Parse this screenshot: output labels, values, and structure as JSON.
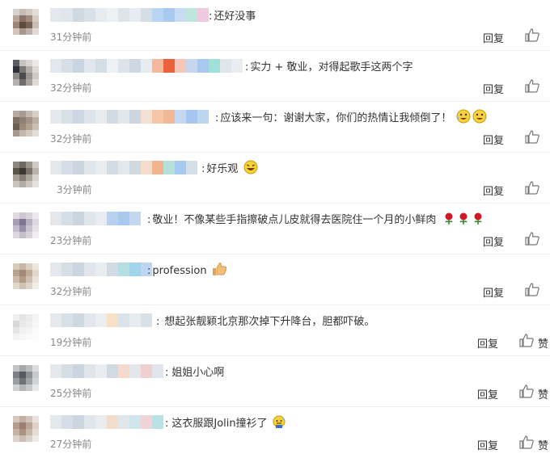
{
  "reply_label": "回复",
  "zan_label": "赞",
  "colors": {
    "text": "#333333",
    "time": "#888888",
    "divider": "#eeeeee"
  },
  "comments": [
    {
      "text": "还好没事",
      "time": "31分钟前"
    },
    {
      "text": "实力 + 敬业，对得起歌手这两个字",
      "time": "32分钟前"
    },
    {
      "text": "应该来一句：谢谢大家，你们的热情让我倾倒了！",
      "time": "32分钟前"
    },
    {
      "text": "好乐观",
      "time": "3分钟前"
    },
    {
      "text": "敬业！不像某些手指擦破点儿皮就得去医院住一个月的小鲜肉",
      "time": "23分钟前"
    },
    {
      "text": "profession",
      "time": "32分钟前"
    },
    {
      "text": "想起张靓颖北京那次掉下升降台，胆都吓破。",
      "time": "19分钟前"
    },
    {
      "text": "姐姐小心啊",
      "time": "25分钟前"
    },
    {
      "text": "这衣服跟Jolin撞衫了",
      "time": "27分钟前"
    }
  ]
}
